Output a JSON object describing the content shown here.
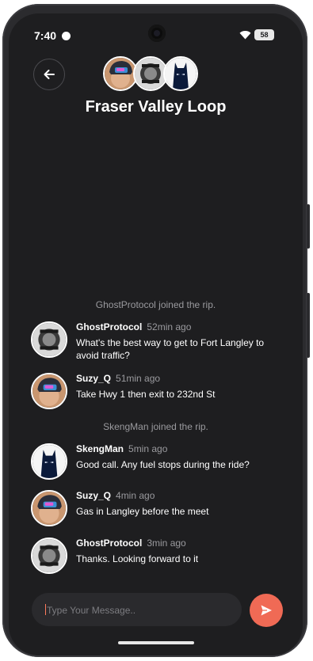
{
  "status_bar": {
    "time": "7:40",
    "battery": "58"
  },
  "header": {
    "title": "Fraser Valley Loop",
    "back_icon": "arrow-left-icon",
    "participants": [
      "Suzy_Q",
      "GhostProtocol",
      "SkengMan"
    ]
  },
  "chat": {
    "events": [
      {
        "type": "system",
        "text": "GhostProtocol joined the rip."
      },
      {
        "type": "message",
        "user": "GhostProtocol",
        "time": "52min ago",
        "text": "What's the best way to get to Fort Langley to avoid traffic?"
      },
      {
        "type": "message",
        "user": "Suzy_Q",
        "time": "51min ago",
        "text": "Take Hwy 1 then exit to 232nd St"
      },
      {
        "type": "system",
        "text": "SkengMan joined the rip."
      },
      {
        "type": "message",
        "user": "SkengMan",
        "time": "5min ago",
        "text": "Good call. Any fuel stops during the ride?"
      },
      {
        "type": "message",
        "user": "Suzy_Q",
        "time": "4min ago",
        "text": "Gas in Langley before the meet"
      },
      {
        "type": "message",
        "user": "GhostProtocol",
        "time": "3min ago",
        "text": "Thanks. Looking forward to it"
      }
    ]
  },
  "composer": {
    "placeholder": "Type Your Message..",
    "send_icon": "send-icon"
  },
  "colors": {
    "background": "#1e1e20",
    "accent": "#f06a55",
    "muted_text": "#9a9a9e"
  }
}
